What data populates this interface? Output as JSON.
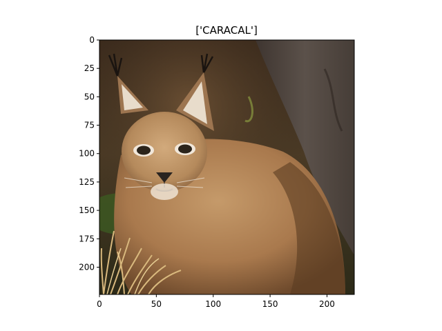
{
  "figure": {
    "title": "['CARACAL']",
    "x_ticks": [
      "0",
      "50",
      "100",
      "150",
      "200"
    ],
    "y_ticks": [
      "0",
      "25",
      "50",
      "75",
      "100",
      "125",
      "150",
      "175",
      "200"
    ]
  },
  "chart_data": {
    "type": "image",
    "title": "['CARACAL']",
    "xlim": [
      0,
      224
    ],
    "ylim": [
      224,
      0
    ],
    "x_ticks": [
      0,
      50,
      100,
      150,
      200
    ],
    "y_ticks": [
      0,
      25,
      50,
      75,
      100,
      125,
      150,
      175,
      200
    ]
  }
}
